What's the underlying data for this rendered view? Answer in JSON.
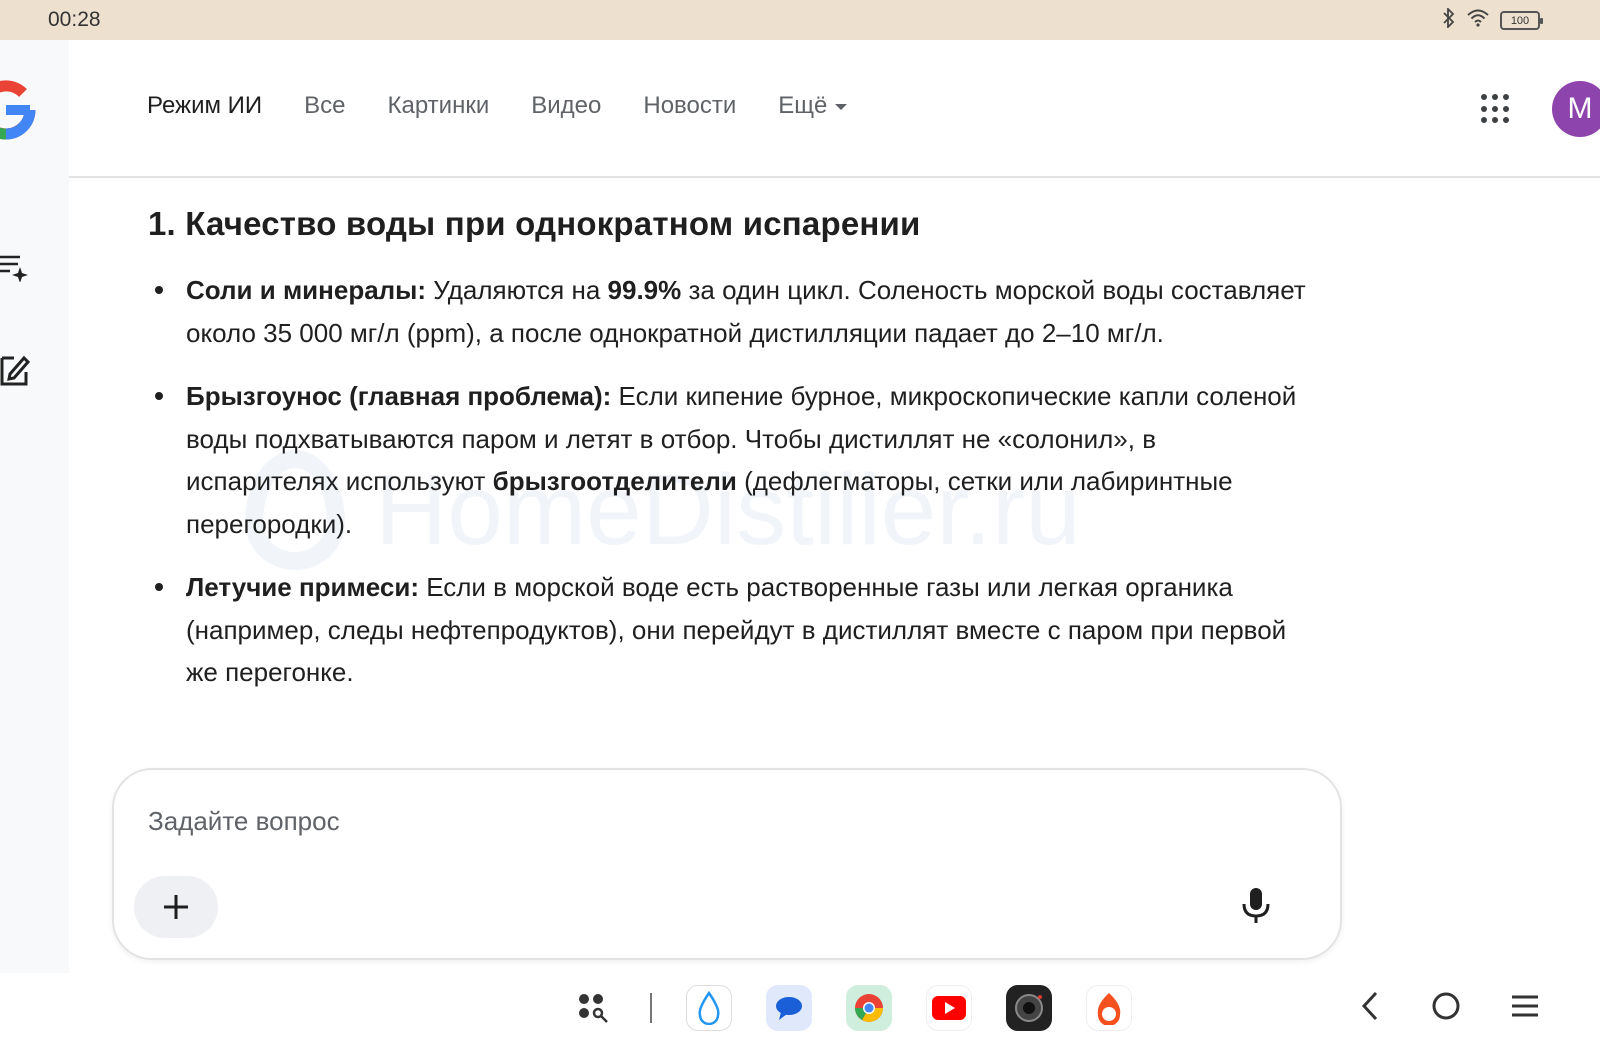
{
  "status": {
    "time": "00:28",
    "battery": "100"
  },
  "header": {
    "tabs": [
      {
        "label": "Режим ИИ",
        "active": true
      },
      {
        "label": "Все"
      },
      {
        "label": "Картинки"
      },
      {
        "label": "Видео"
      },
      {
        "label": "Новости"
      },
      {
        "label": "Ещё"
      }
    ],
    "avatar_letter": "M"
  },
  "content": {
    "heading": "1. Качество воды при однократном испарении",
    "bullets": [
      {
        "bold": "Соли и минералы:",
        "t1": " Удаляются на ",
        "bold2": "99.9%",
        "t2": " за один цикл. Соленость морской воды составляет около 35 000 мг/л (ppm), а после однократной дистилляции падает до 2–10 мг/л."
      },
      {
        "bold": "Брызгоунос (главная проблема):",
        "t1": " Если кипение бурное, микроскопические капли соленой воды подхватываются паром и летят в отбор. Чтобы дистиллят не «солонил», в испарителях используют ",
        "bold2": "брызгоотделители",
        "t2": " (дефлегматоры, сетки или лабиринтные перегородки)."
      },
      {
        "bold": "Летучие примеси:",
        "t1": " Если в морской воде есть растворенные газы или легкая органика (например, следы нефтепродуктов), они перейдут в дистиллят вместе с паром при первой же перегонке."
      }
    ]
  },
  "watermark": "HomeDistiller.ru",
  "ask": {
    "placeholder": "Задайте вопрос"
  },
  "icons": [
    "google-logo",
    "new-chat-icon",
    "edit-icon",
    "apps-grid-icon",
    "mic-icon",
    "plus-icon",
    "bluetooth-icon",
    "wifi-icon"
  ]
}
